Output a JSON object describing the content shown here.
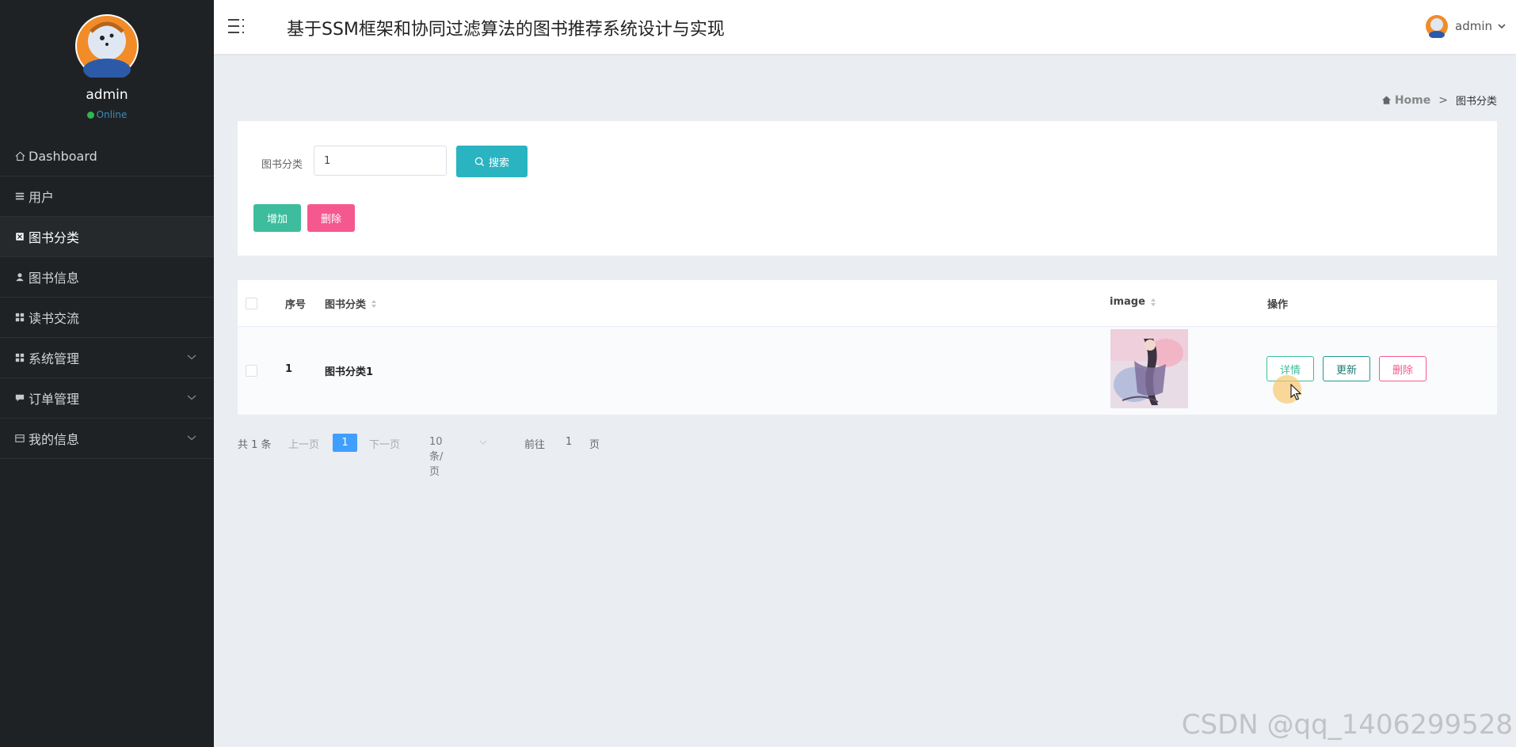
{
  "sidebar": {
    "user_name": "admin",
    "status": "Online",
    "items": [
      {
        "label": "Dashboard",
        "icon": "home-icon",
        "active": false
      },
      {
        "label": "用户",
        "icon": "list-icon",
        "active": false
      },
      {
        "label": "图书分类",
        "icon": "book-icon",
        "active": true
      },
      {
        "label": "图书信息",
        "icon": "person-icon",
        "active": false
      },
      {
        "label": "读书交流",
        "icon": "grid-icon",
        "active": false
      },
      {
        "label": "系统管理",
        "icon": "grid-icon",
        "active": false
      },
      {
        "label": "订单管理",
        "icon": "comment-icon",
        "active": false
      },
      {
        "label": "我的信息",
        "icon": "card-icon",
        "active": false
      }
    ]
  },
  "header": {
    "title": "基于SSM框架和协同过滤算法的图书推荐系统设计与实现",
    "user": "admin"
  },
  "breadcrumb": {
    "home": "Home",
    "separator": ">",
    "current": "图书分类"
  },
  "search": {
    "label": "图书分类",
    "value": "1",
    "button": "搜索"
  },
  "actions": {
    "add": "增加",
    "delete": "删除"
  },
  "table": {
    "columns": [
      "序号",
      "图书分类",
      "image",
      "操作"
    ],
    "rows": [
      {
        "index": "1",
        "category": "图书分类1",
        "image": "book-cover-image",
        "ops": {
          "detail": "详情",
          "update": "更新",
          "delete": "删除"
        }
      }
    ]
  },
  "pagination": {
    "total": "共 1 条",
    "prev": "上一页",
    "current": "1",
    "next": "下一页",
    "page_size": "10条/页",
    "goto_label": "前往",
    "goto_value": "1",
    "goto_suffix": "页"
  },
  "watermark": "CSDN @qq_1406299528",
  "colors": {
    "sidebar_bg": "#1f2224",
    "accent_teal": "#2ab3c1",
    "add_green": "#3dbd9e",
    "delete_pink": "#f5588f",
    "pager_blue": "#409eff"
  }
}
